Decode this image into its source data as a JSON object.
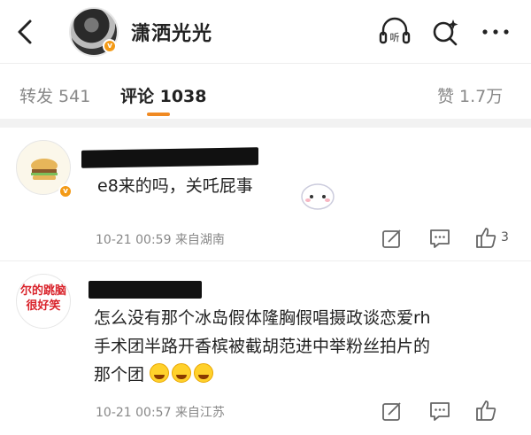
{
  "header": {
    "username": "潇洒光光",
    "listen_label": "听",
    "verified": "v"
  },
  "tabs": [
    {
      "label": "转发 541",
      "active": false
    },
    {
      "label": "评论 1038",
      "active": true
    },
    {
      "label": "赞 1.7万",
      "active": false
    }
  ],
  "comments": [
    {
      "text": "e8来的吗，关吒屁事",
      "time": "10-21 00:59",
      "location": "来自湖南",
      "likes": "3",
      "avatar_badge": "v"
    },
    {
      "avatar_text_line1": "尔的跳脑",
      "avatar_text_line2": "很好笑",
      "lines": [
        "怎么没有那个冰岛假体隆胸假唱摄政谈恋爱rh",
        "手术团半路开香槟被截胡范进中举粉丝拍片的",
        "那个团"
      ],
      "time": "10-21 00:57",
      "location": "来自江苏"
    }
  ],
  "colors": {
    "accent": "#f08a23",
    "verified": "#f39a16",
    "text": "#222222",
    "meta": "#888888"
  }
}
